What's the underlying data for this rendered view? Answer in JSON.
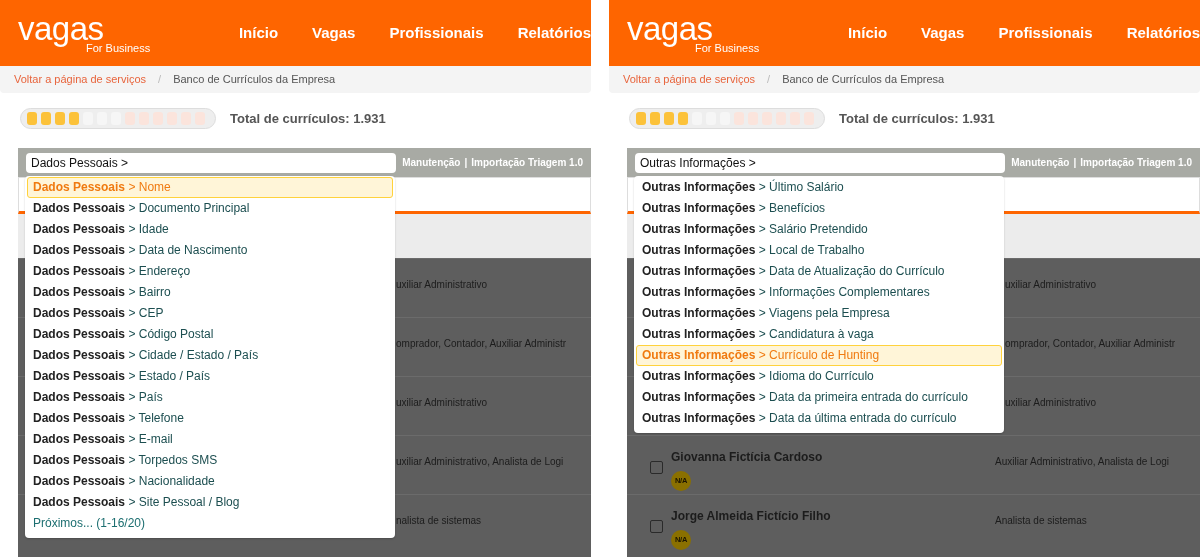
{
  "panels": [
    {
      "header": {
        "logo": "vagas",
        "logo_sub": "For Business",
        "nav": [
          "Início",
          "Vagas",
          "Profissionais",
          "Relatórios"
        ]
      },
      "breadcrumb": {
        "link": "Voltar a página de serviços",
        "separator": "/",
        "current": "Banco de Currículos da Empresa"
      },
      "progress": {
        "level": 0.31
      },
      "total": "Total de currículos: 1.931",
      "search": {
        "value": "Dados Pessoais >"
      },
      "toolbar_links": [
        "Manutenção",
        "|",
        "Importação Triagem 1.0"
      ],
      "rows": [
        {
          "role": "uxiliar Administrativo"
        },
        {
          "role": "omprador, Contador, Auxiliar Administr"
        },
        {
          "role": "uxiliar Administrativo"
        },
        {
          "role": "uxiliar Administrativo, Analista de Logi"
        },
        {
          "role": "nalista de sistemas"
        }
      ],
      "dropdown": [
        {
          "kind": "option",
          "text": "**Dados Pessoais** > Nome",
          "selected": true
        },
        {
          "kind": "option",
          "text": "**Dados Pessoais** > Documento Principal",
          "selected": false
        },
        {
          "kind": "option",
          "text": "**Dados Pessoais** > Idade",
          "selected": false
        },
        {
          "kind": "option",
          "text": "**Dados Pessoais** > Data de Nascimento",
          "selected": false
        },
        {
          "kind": "option",
          "text": "**Dados Pessoais** > Endereço",
          "selected": false
        },
        {
          "kind": "option",
          "text": "**Dados Pessoais** > Bairro",
          "selected": false
        },
        {
          "kind": "option",
          "text": "**Dados Pessoais** > CEP",
          "selected": false
        },
        {
          "kind": "option",
          "text": "**Dados Pessoais** > Código Postal",
          "selected": false
        },
        {
          "kind": "option",
          "text": "**Dados Pessoais** > Cidade / Estado / País",
          "selected": false
        },
        {
          "kind": "option",
          "text": "**Dados Pessoais** > Estado / País",
          "selected": false
        },
        {
          "kind": "option",
          "text": "**Dados Pessoais** > País",
          "selected": false
        },
        {
          "kind": "option",
          "text": "**Dados Pessoais** > Telefone",
          "selected": false
        },
        {
          "kind": "option",
          "text": "**Dados Pessoais** > E-mail",
          "selected": false
        },
        {
          "kind": "option",
          "text": "**Dados Pessoais** > Torpedos SMS",
          "selected": false
        },
        {
          "kind": "option",
          "text": "**Dados Pessoais** > Nacionalidade",
          "selected": false
        },
        {
          "kind": "option",
          "text": "**Dados Pessoais** > Site Pessoal / Blog",
          "selected": false
        },
        {
          "kind": "more",
          "text": "Próximos... (1-16/20)",
          "selected": false
        }
      ]
    },
    {
      "header": {
        "logo": "vagas",
        "logo_sub": "For Business",
        "nav": [
          "Início",
          "Vagas",
          "Profissionais",
          "Relatórios"
        ]
      },
      "breadcrumb": {
        "link": "Voltar a página de serviços",
        "separator": "/",
        "current": "Banco de Currículos da Empresa"
      },
      "progress": {
        "level": 0.31
      },
      "total": "Total de currículos: 1.931",
      "search": {
        "value": "Outras Informações >"
      },
      "toolbar_links": [
        "Manutenção",
        "|",
        "Importação Triagem 1.0"
      ],
      "rows": [
        {
          "role": "uxiliar Administrativo"
        },
        {
          "role": "omprador, Contador, Auxiliar Administr"
        },
        {
          "role": "uxiliar Administrativo"
        },
        {
          "name": "Giovanna Fictícia Cardoso",
          "badge": "N/A",
          "checked": false,
          "role": "Auxiliar Administrativo, Analista de Logi"
        },
        {
          "name": "Jorge Almeida Fictício Filho",
          "badge": "N/A",
          "checked": false,
          "role": "Analista de sistemas"
        }
      ],
      "dropdown": [
        {
          "kind": "option",
          "text": "**Outras Informações** > Último Salário",
          "selected": false
        },
        {
          "kind": "option",
          "text": "**Outras Informações** > Benefícios",
          "selected": false
        },
        {
          "kind": "option",
          "text": "**Outras Informações** > Salário Pretendido",
          "selected": false
        },
        {
          "kind": "option",
          "text": "**Outras Informações** > Local de Trabalho",
          "selected": false
        },
        {
          "kind": "option",
          "text": "**Outras Informações** > Data de Atualização do Currículo",
          "selected": false
        },
        {
          "kind": "option",
          "text": "**Outras Informações** > Informações Complementares",
          "selected": false
        },
        {
          "kind": "option",
          "text": "**Outras Informações** > Viagens pela Empresa",
          "selected": false
        },
        {
          "kind": "option",
          "text": "**Outras Informações** > Candidatura à vaga",
          "selected": false
        },
        {
          "kind": "option",
          "text": "**Outras Informações** > Currículo de Hunting",
          "selected": true
        },
        {
          "kind": "option",
          "text": "**Outras Informações** > Idioma do Currículo",
          "selected": false
        },
        {
          "kind": "option",
          "text": "**Outras Informações** > Data da primeira entrada do currículo",
          "selected": false
        },
        {
          "kind": "option",
          "text": "**Outras Informações** > Data da última entrada do currículo",
          "selected": false
        }
      ]
    }
  ]
}
